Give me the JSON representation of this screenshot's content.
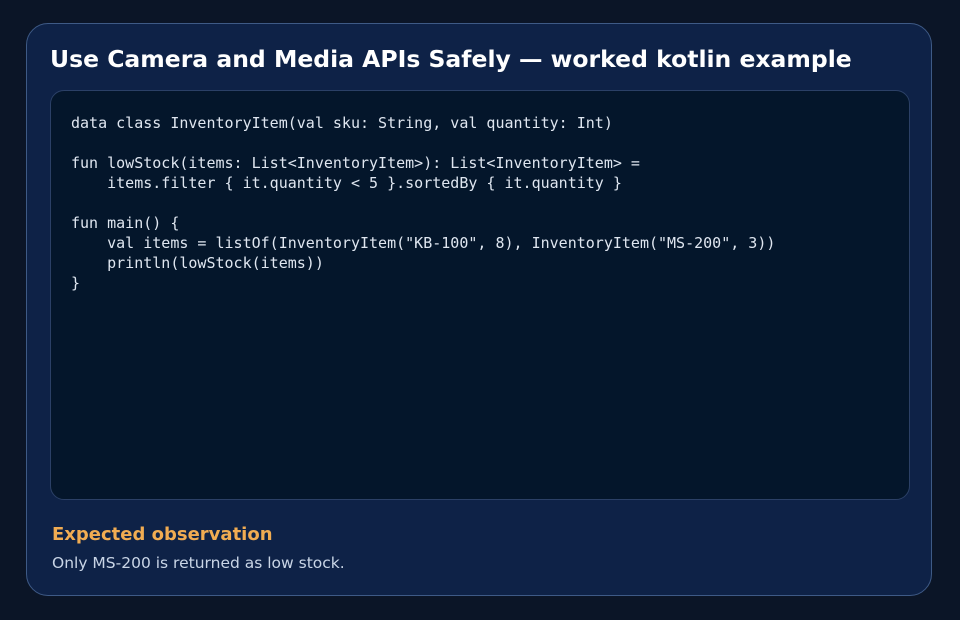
{
  "title": "Use Camera and Media APIs Safely — worked kotlin example",
  "code": {
    "language": "kotlin",
    "text": "data class InventoryItem(val sku: String, val quantity: Int)\n\nfun lowStock(items: List<InventoryItem>): List<InventoryItem> =\n    items.filter { it.quantity < 5 }.sortedBy { it.quantity }\n\nfun main() {\n    val items = listOf(InventoryItem(\"KB-100\", 8), InventoryItem(\"MS-200\", 3))\n    println(lowStock(items))\n}"
  },
  "observation": {
    "heading": "Expected observation",
    "text": "Only MS-200 is returned as low stock."
  },
  "colors": {
    "page_background": "#0b1527",
    "card_background": "#0e2247",
    "code_background": "#04162b",
    "accent": "#f1ac52"
  }
}
